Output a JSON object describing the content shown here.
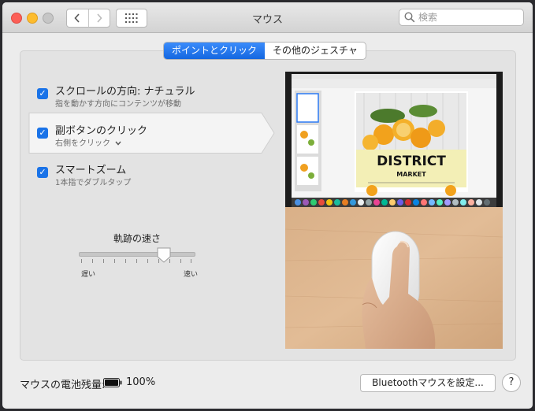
{
  "window": {
    "title": "マウス"
  },
  "search": {
    "placeholder": "検索"
  },
  "tabs": [
    {
      "label": "ポイントとクリック",
      "active": true
    },
    {
      "label": "その他のジェスチャ",
      "active": false
    }
  ],
  "options": [
    {
      "label": "スクロールの方向: ナチュラル",
      "description": "指を動かす方向にコンテンツが移動",
      "checked": true
    },
    {
      "label": "副ボタンのクリック",
      "description": "右側をクリック",
      "checked": true,
      "selected": true,
      "has_dropdown": true
    },
    {
      "label": "スマートズーム",
      "description": "1本指でダブルタップ",
      "checked": true
    }
  ],
  "tracking": {
    "title": "軌跡の速さ",
    "min_label": "遅い",
    "max_label": "速い",
    "value": 0.75
  },
  "preview": {
    "flyer_title": "DISTRICT",
    "flyer_subtitle": "MARKET"
  },
  "battery": {
    "label": "マウスの電池残量:",
    "value": "100%"
  },
  "bluetooth_button": "Bluetoothマウスを設定...",
  "help_button": "?",
  "colors": {
    "accent": "#1a73e8",
    "window_bg": "#ececec"
  }
}
